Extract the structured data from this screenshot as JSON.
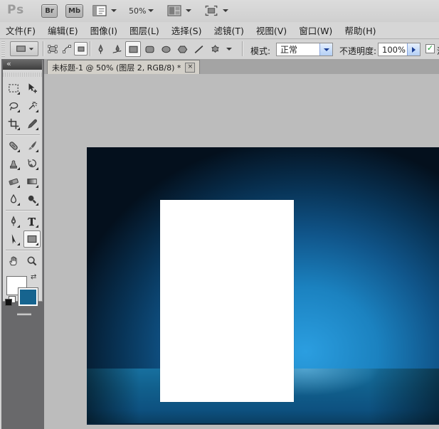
{
  "titlebar": {
    "logo": "Ps",
    "bridge_button": "Br",
    "mini_bridge_button": "Mb",
    "zoom_level": "50%"
  },
  "menu": {
    "items": [
      "文件(F)",
      "编辑(E)",
      "图像(I)",
      "图层(L)",
      "选择(S)",
      "滤镜(T)",
      "视图(V)",
      "窗口(W)",
      "帮助(H)"
    ]
  },
  "options_bar": {
    "drawing_modes": [
      {
        "name": "shape-layers",
        "selected": false
      },
      {
        "name": "paths",
        "selected": false
      },
      {
        "name": "fill-pixels",
        "selected": true
      }
    ],
    "shape_tools": [
      {
        "name": "pen",
        "selected": false
      },
      {
        "name": "freeform-pen",
        "selected": false
      },
      {
        "name": "rectangle",
        "selected": true
      },
      {
        "name": "rounded-rectangle",
        "selected": false
      },
      {
        "name": "ellipse",
        "selected": false
      },
      {
        "name": "polygon",
        "selected": false
      },
      {
        "name": "line",
        "selected": false
      },
      {
        "name": "custom-shape",
        "selected": false
      }
    ],
    "mode_label": "模式:",
    "mode_value": "正常",
    "opacity_label": "不透明度:",
    "opacity_value": "100%",
    "antialias_checked": true,
    "antialias_check_glyph": "✓",
    "antialias_label_partial": "消"
  },
  "document_tab": {
    "title": "未标题-1 @ 50% (图层 2, RGB/8) *",
    "close_glyph": "×"
  },
  "toolbox": {
    "collapse_glyph": "«",
    "swap_glyph": "⇄",
    "foreground_color": "#ffffff",
    "background_color": "#16648f",
    "tools": [
      {
        "name": "rectangular-marquee",
        "selected": false,
        "flyout": true
      },
      {
        "name": "move",
        "selected": false,
        "flyout": false
      },
      {
        "name": "lasso",
        "selected": false,
        "flyout": true
      },
      {
        "name": "magic-wand",
        "selected": false,
        "flyout": true
      },
      {
        "name": "crop",
        "selected": false,
        "flyout": true
      },
      {
        "name": "eyedropper",
        "selected": false,
        "flyout": true
      },
      {
        "name": "healing-brush",
        "selected": false,
        "flyout": true
      },
      {
        "name": "brush",
        "selected": false,
        "flyout": true
      },
      {
        "name": "clone-stamp",
        "selected": false,
        "flyout": true
      },
      {
        "name": "history-brush",
        "selected": false,
        "flyout": true
      },
      {
        "name": "eraser",
        "selected": false,
        "flyout": true
      },
      {
        "name": "gradient",
        "selected": false,
        "flyout": true
      },
      {
        "name": "blur",
        "selected": false,
        "flyout": true
      },
      {
        "name": "dodge",
        "selected": false,
        "flyout": true
      },
      {
        "name": "pen",
        "selected": false,
        "flyout": true
      },
      {
        "name": "type",
        "selected": false,
        "flyout": true
      },
      {
        "name": "path-selection",
        "selected": false,
        "flyout": true
      },
      {
        "name": "rectangle",
        "selected": true,
        "flyout": true
      },
      {
        "name": "hand",
        "selected": false,
        "flyout": false
      },
      {
        "name": "zoom",
        "selected": false,
        "flyout": false
      }
    ],
    "tool_groups": [
      6,
      8,
      4,
      2
    ]
  },
  "canvas": {
    "glow_color": "#2b9ee0",
    "mid_color": "#10558a",
    "edge_color": "#04101d",
    "band_color": "#11608d",
    "shape_color": "#ffffff"
  }
}
